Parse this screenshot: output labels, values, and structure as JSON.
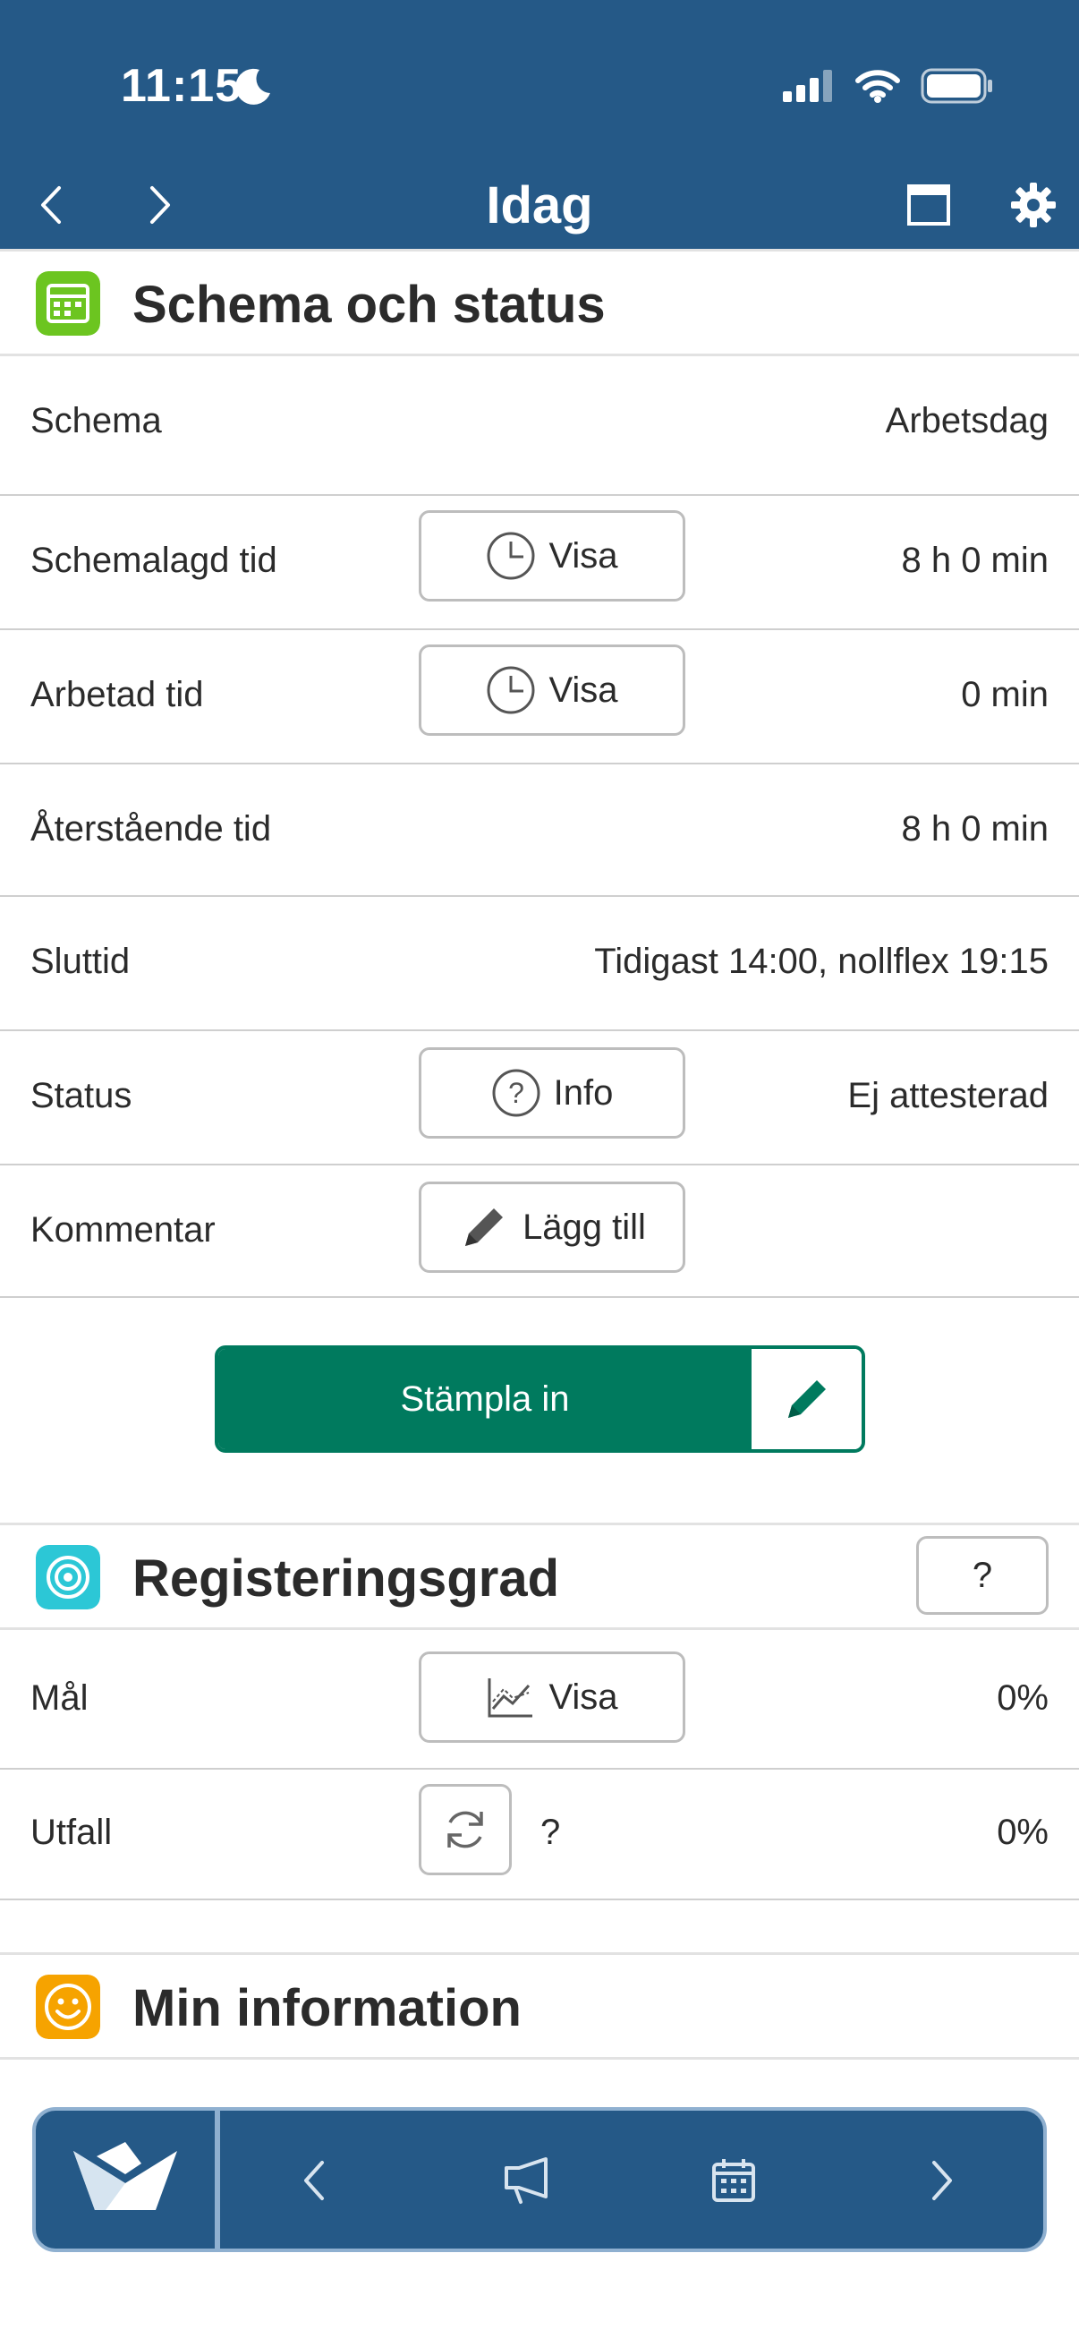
{
  "status_bar": {
    "time": "11:15"
  },
  "nav": {
    "title": "Idag"
  },
  "schema_section": {
    "title": "Schema och status",
    "rows": {
      "schema": {
        "label": "Schema",
        "value": "Arbetsdag"
      },
      "scheduled": {
        "label": "Schemalagd tid",
        "button": "Visa",
        "value": "8 h 0 min"
      },
      "worked": {
        "label": "Arbetad tid",
        "button": "Visa",
        "value": "0 min"
      },
      "remaining": {
        "label": "Återstående tid",
        "value": "8 h 0 min"
      },
      "end": {
        "label": "Sluttid",
        "value": "Tidigast 14:00, nollflex 19:15"
      },
      "status": {
        "label": "Status",
        "button": "Info",
        "value": "Ej attesterad"
      },
      "comment": {
        "label": "Kommentar",
        "button": "Lägg till"
      }
    },
    "stamp_button": "Stämpla in"
  },
  "reg_section": {
    "title": "Registeringsgrad",
    "help_button": "?",
    "rows": {
      "goal": {
        "label": "Mål",
        "button": "Visa",
        "value": "0%"
      },
      "outcome": {
        "label": "Utfall",
        "mark": "?",
        "value": "0%"
      }
    }
  },
  "info_section": {
    "title": "Min information"
  },
  "colors": {
    "header": "#255987",
    "stamp": "#007a5e",
    "schema_icon": "#6cc520",
    "reg_icon": "#2cc7d6",
    "info_icon": "#f6a300"
  }
}
